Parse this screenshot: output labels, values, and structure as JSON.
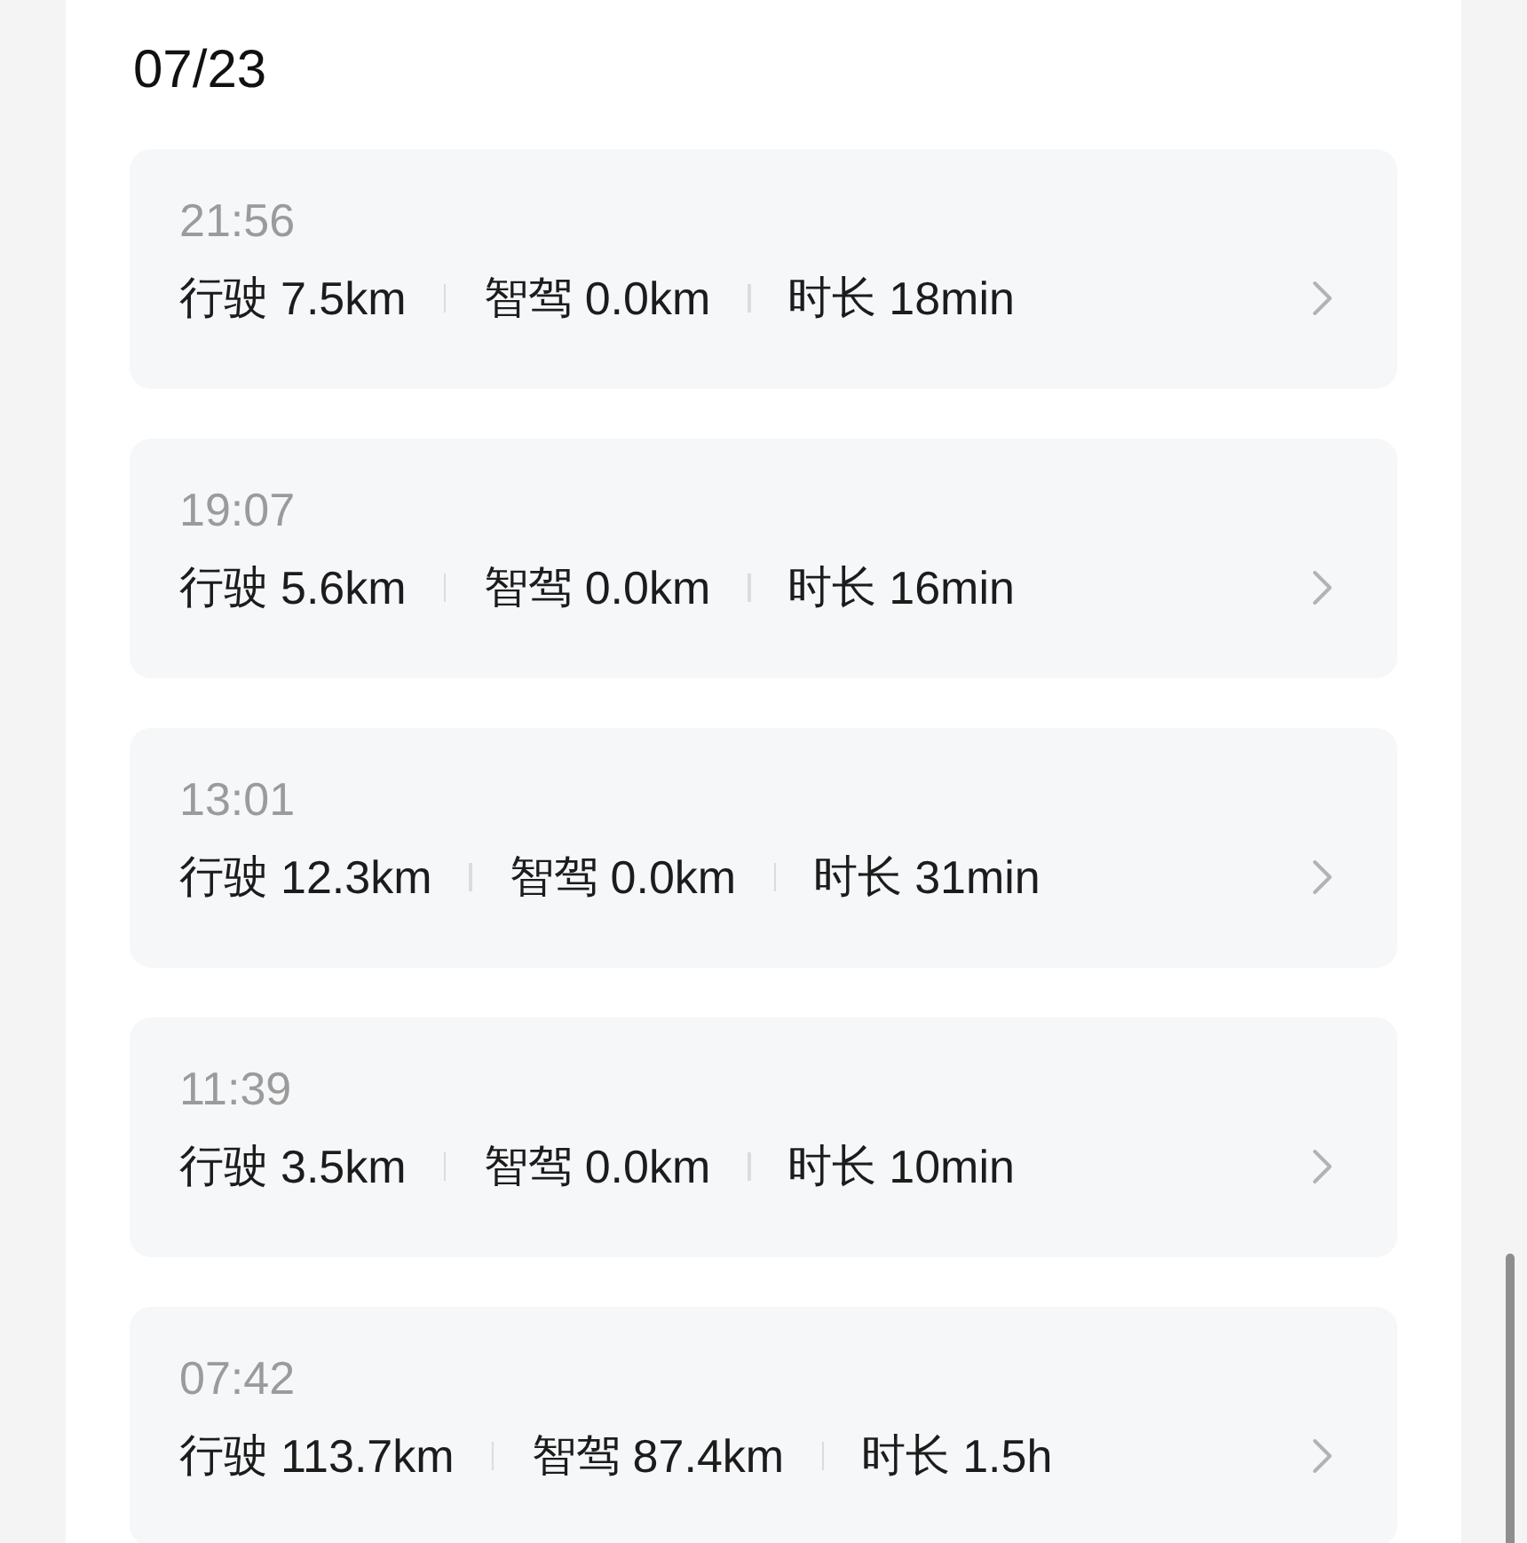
{
  "date_header": "07/23",
  "trips": [
    {
      "time": "21:56",
      "stats": [
        {
          "label": "行驶",
          "value": "7.5km"
        },
        {
          "label": "智驾",
          "value": "0.0km"
        },
        {
          "label": "时长",
          "value": "18min"
        }
      ]
    },
    {
      "time": "19:07",
      "stats": [
        {
          "label": "行驶",
          "value": "5.6km"
        },
        {
          "label": "智驾",
          "value": "0.0km"
        },
        {
          "label": "时长",
          "value": "16min"
        }
      ]
    },
    {
      "time": "13:01",
      "stats": [
        {
          "label": "行驶",
          "value": "12.3km"
        },
        {
          "label": "智驾",
          "value": "0.0km"
        },
        {
          "label": "时长",
          "value": "31min"
        }
      ]
    },
    {
      "time": "11:39",
      "stats": [
        {
          "label": "行驶",
          "value": "3.5km"
        },
        {
          "label": "智驾",
          "value": "0.0km"
        },
        {
          "label": "时长",
          "value": "10min"
        }
      ]
    },
    {
      "time": "07:42",
      "stats": [
        {
          "label": "行驶",
          "value": "113.7km"
        },
        {
          "label": "智驾",
          "value": "87.4km"
        },
        {
          "label": "时长",
          "value": "1.5h"
        }
      ]
    }
  ]
}
